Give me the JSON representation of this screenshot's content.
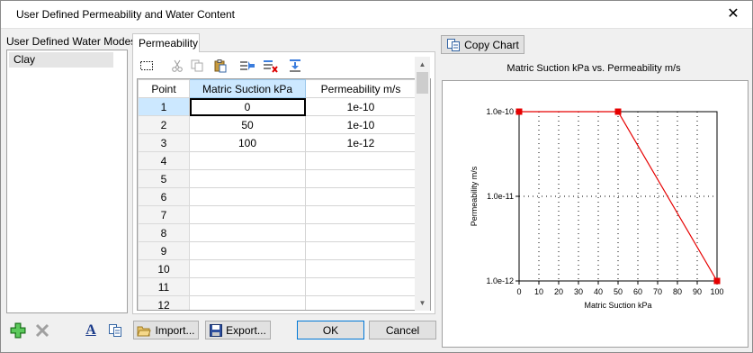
{
  "window": {
    "title": "User Defined Permeability and Water Content",
    "close_glyph": "✕"
  },
  "modes": {
    "label": "User Defined Water Modes:",
    "items": [
      "Clay"
    ]
  },
  "tabs": [
    {
      "label": "Permeability"
    }
  ],
  "toolbar": {
    "icons": [
      "select-all-icon",
      "cut-icon",
      "copy-icon",
      "paste-icon",
      "insert-row-icon",
      "delete-row-icon",
      "append-row-icon"
    ]
  },
  "table": {
    "headers": [
      "Point",
      "Matric Suction kPa",
      "Permeability m/s"
    ],
    "rows": [
      [
        "1",
        "0",
        "1e-10"
      ],
      [
        "2",
        "50",
        "1e-10"
      ],
      [
        "3",
        "100",
        "1e-12"
      ],
      [
        "4",
        "",
        ""
      ],
      [
        "5",
        "",
        ""
      ],
      [
        "6",
        "",
        ""
      ],
      [
        "7",
        "",
        ""
      ],
      [
        "8",
        "",
        ""
      ],
      [
        "9",
        "",
        ""
      ],
      [
        "10",
        "",
        ""
      ],
      [
        "11",
        "",
        ""
      ],
      [
        "12",
        "",
        ""
      ]
    ]
  },
  "buttons": {
    "copy_chart": "Copy Chart",
    "import": "Import...",
    "export": "Export...",
    "ok": "OK",
    "cancel": "Cancel",
    "font_glyph": "A"
  },
  "colors": {
    "series": "#e60000",
    "grid": "#000000",
    "selection": "#cce8ff"
  },
  "chart_data": {
    "type": "line",
    "title": "Matric Suction kPa vs. Permeability m/s",
    "xlabel": "Matric Suction kPa",
    "ylabel": "Permeability m/s",
    "xlim": [
      0,
      100
    ],
    "ylim": [
      1e-12,
      1e-10
    ],
    "yscale": "log",
    "grid": true,
    "x_ticks": [
      0,
      10,
      20,
      30,
      40,
      50,
      60,
      70,
      80,
      90,
      100
    ],
    "y_ticks": [
      "1.0e-10",
      "1.0e-11",
      "1.0e-12"
    ],
    "y_tick_values": [
      1e-10,
      1e-11,
      1e-12
    ],
    "series": [
      {
        "x": [
          0,
          50,
          100
        ],
        "y": [
          1e-10,
          1e-10,
          1e-12
        ]
      }
    ]
  }
}
